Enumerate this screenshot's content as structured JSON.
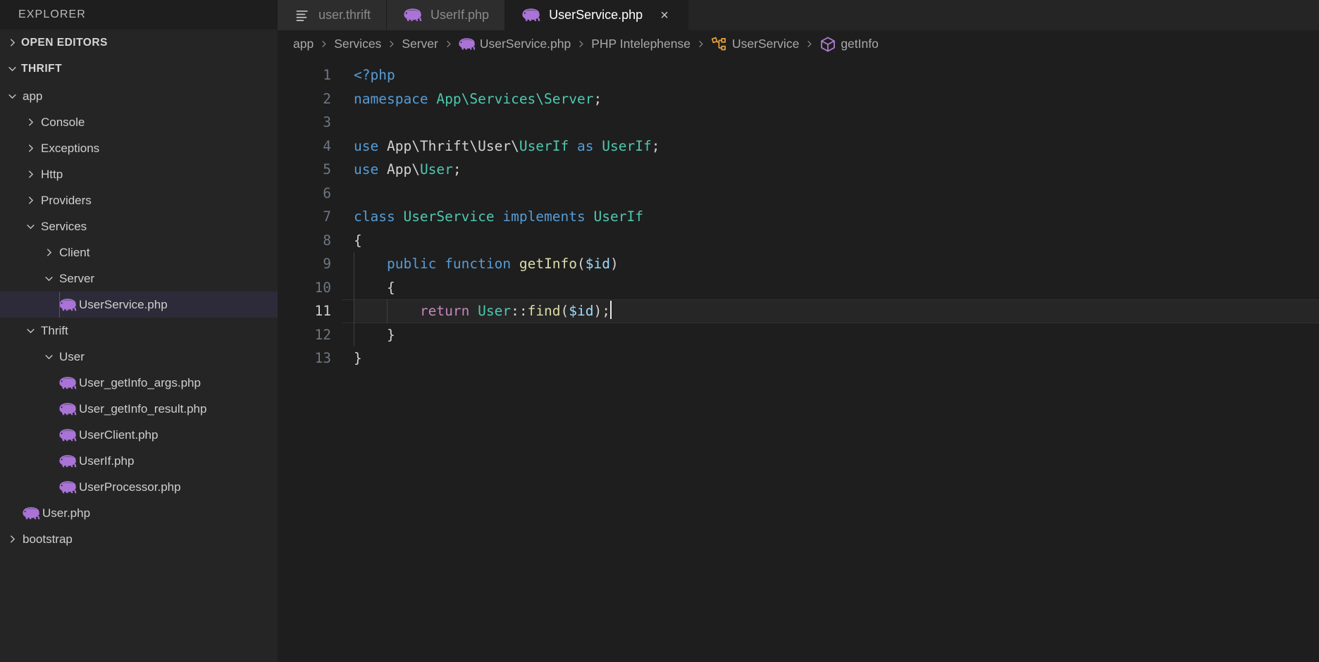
{
  "sidebar": {
    "title": "EXPLORER",
    "sections": [
      {
        "label": "OPEN EDITORS",
        "expanded": false
      },
      {
        "label": "THRIFT",
        "expanded": true
      }
    ],
    "tree": [
      {
        "label": "app",
        "type": "folder",
        "expanded": true,
        "depth": 1
      },
      {
        "label": "Console",
        "type": "folder",
        "expanded": false,
        "depth": 2
      },
      {
        "label": "Exceptions",
        "type": "folder",
        "expanded": false,
        "depth": 2
      },
      {
        "label": "Http",
        "type": "folder",
        "expanded": false,
        "depth": 2
      },
      {
        "label": "Providers",
        "type": "folder",
        "expanded": false,
        "depth": 2
      },
      {
        "label": "Services",
        "type": "folder",
        "expanded": true,
        "depth": 2
      },
      {
        "label": "Client",
        "type": "folder",
        "expanded": false,
        "depth": 3
      },
      {
        "label": "Server",
        "type": "folder",
        "expanded": true,
        "depth": 3
      },
      {
        "label": "UserService.php",
        "type": "php",
        "depth": 4,
        "selected": true
      },
      {
        "label": "Thrift",
        "type": "folder",
        "expanded": true,
        "depth": 2
      },
      {
        "label": "User",
        "type": "folder",
        "expanded": true,
        "depth": 3
      },
      {
        "label": "User_getInfo_args.php",
        "type": "php",
        "depth": 4
      },
      {
        "label": "User_getInfo_result.php",
        "type": "php",
        "depth": 4
      },
      {
        "label": "UserClient.php",
        "type": "php",
        "depth": 4
      },
      {
        "label": "UserIf.php",
        "type": "php",
        "depth": 4
      },
      {
        "label": "UserProcessor.php",
        "type": "php",
        "depth": 4
      },
      {
        "label": "User.php",
        "type": "php",
        "depth": 2
      },
      {
        "label": "bootstrap",
        "type": "folder",
        "expanded": false,
        "depth": 1
      }
    ]
  },
  "tabs": [
    {
      "label": "user.thrift",
      "icon": "thrift-lines-icon",
      "active": false,
      "closable": false
    },
    {
      "label": "UserIf.php",
      "icon": "php-elephant-icon",
      "active": false,
      "closable": false
    },
    {
      "label": "UserService.php",
      "icon": "php-elephant-icon",
      "active": true,
      "closable": true,
      "close_label": "×"
    }
  ],
  "breadcrumb": [
    {
      "label": "app",
      "icon": null
    },
    {
      "label": "Services",
      "icon": null
    },
    {
      "label": "Server",
      "icon": null
    },
    {
      "label": "UserService.php",
      "icon": "php-elephant-icon"
    },
    {
      "label": "PHP Intelephense",
      "icon": null
    },
    {
      "label": "UserService",
      "icon": "symbol-class-icon"
    },
    {
      "label": "getInfo",
      "icon": "symbol-method-icon"
    }
  ],
  "editor": {
    "language": "php",
    "cursor_line": 11,
    "line_numbers": [
      1,
      2,
      3,
      4,
      5,
      6,
      7,
      8,
      9,
      10,
      11,
      12,
      13
    ],
    "lines": [
      {
        "n": 1,
        "tokens": [
          {
            "t": "<?php",
            "c": "kw"
          }
        ]
      },
      {
        "n": 2,
        "tokens": [
          {
            "t": "namespace",
            "c": "kw"
          },
          {
            "t": " ",
            "c": "pl"
          },
          {
            "t": "App\\Services\\Server",
            "c": "type"
          },
          {
            "t": ";",
            "c": "pun"
          }
        ]
      },
      {
        "n": 3,
        "tokens": []
      },
      {
        "n": 4,
        "tokens": [
          {
            "t": "use",
            "c": "kw"
          },
          {
            "t": " App\\Thrift\\User\\",
            "c": "pl"
          },
          {
            "t": "UserIf",
            "c": "type"
          },
          {
            "t": " ",
            "c": "pl"
          },
          {
            "t": "as",
            "c": "kw"
          },
          {
            "t": " ",
            "c": "pl"
          },
          {
            "t": "UserIf",
            "c": "type"
          },
          {
            "t": ";",
            "c": "pun"
          }
        ]
      },
      {
        "n": 5,
        "tokens": [
          {
            "t": "use",
            "c": "kw"
          },
          {
            "t": " App\\",
            "c": "pl"
          },
          {
            "t": "User",
            "c": "type"
          },
          {
            "t": ";",
            "c": "pun"
          }
        ]
      },
      {
        "n": 6,
        "tokens": []
      },
      {
        "n": 7,
        "tokens": [
          {
            "t": "class",
            "c": "kw"
          },
          {
            "t": " ",
            "c": "pl"
          },
          {
            "t": "UserService",
            "c": "type"
          },
          {
            "t": " ",
            "c": "pl"
          },
          {
            "t": "implements",
            "c": "kw"
          },
          {
            "t": " ",
            "c": "pl"
          },
          {
            "t": "UserIf",
            "c": "type"
          }
        ]
      },
      {
        "n": 8,
        "tokens": [
          {
            "t": "{",
            "c": "pun"
          }
        ]
      },
      {
        "n": 9,
        "tokens": [
          {
            "t": "    ",
            "c": "pl"
          },
          {
            "t": "public",
            "c": "kw"
          },
          {
            "t": " ",
            "c": "pl"
          },
          {
            "t": "function",
            "c": "kw"
          },
          {
            "t": " ",
            "c": "pl"
          },
          {
            "t": "getInfo",
            "c": "fn"
          },
          {
            "t": "(",
            "c": "pun"
          },
          {
            "t": "$id",
            "c": "var"
          },
          {
            "t": ")",
            "c": "pun"
          }
        ]
      },
      {
        "n": 10,
        "tokens": [
          {
            "t": "    {",
            "c": "pun"
          }
        ]
      },
      {
        "n": 11,
        "tokens": [
          {
            "t": "        ",
            "c": "pl"
          },
          {
            "t": "return",
            "c": "kw2"
          },
          {
            "t": " ",
            "c": "pl"
          },
          {
            "t": "User",
            "c": "type"
          },
          {
            "t": "::",
            "c": "pun"
          },
          {
            "t": "find",
            "c": "fn"
          },
          {
            "t": "(",
            "c": "pun"
          },
          {
            "t": "$id",
            "c": "var"
          },
          {
            "t": ");",
            "c": "pun"
          }
        ]
      },
      {
        "n": 12,
        "tokens": [
          {
            "t": "    }",
            "c": "pun"
          }
        ]
      },
      {
        "n": 13,
        "tokens": [
          {
            "t": "}",
            "c": "pun"
          }
        ]
      }
    ]
  },
  "colors": {
    "sidebar_bg": "#252526",
    "editor_bg": "#1e1e1e",
    "selected_row_bg": "#2d2b39",
    "php_icon": "#a974d6",
    "class_icon": "#e8a33d",
    "method_icon": "#b180d7",
    "keyword": "#569cd6",
    "control_keyword": "#c586c0",
    "type": "#4ec9b0",
    "function": "#dcdcaa",
    "variable": "#9cdcfe",
    "plain": "#d4d4d4"
  }
}
